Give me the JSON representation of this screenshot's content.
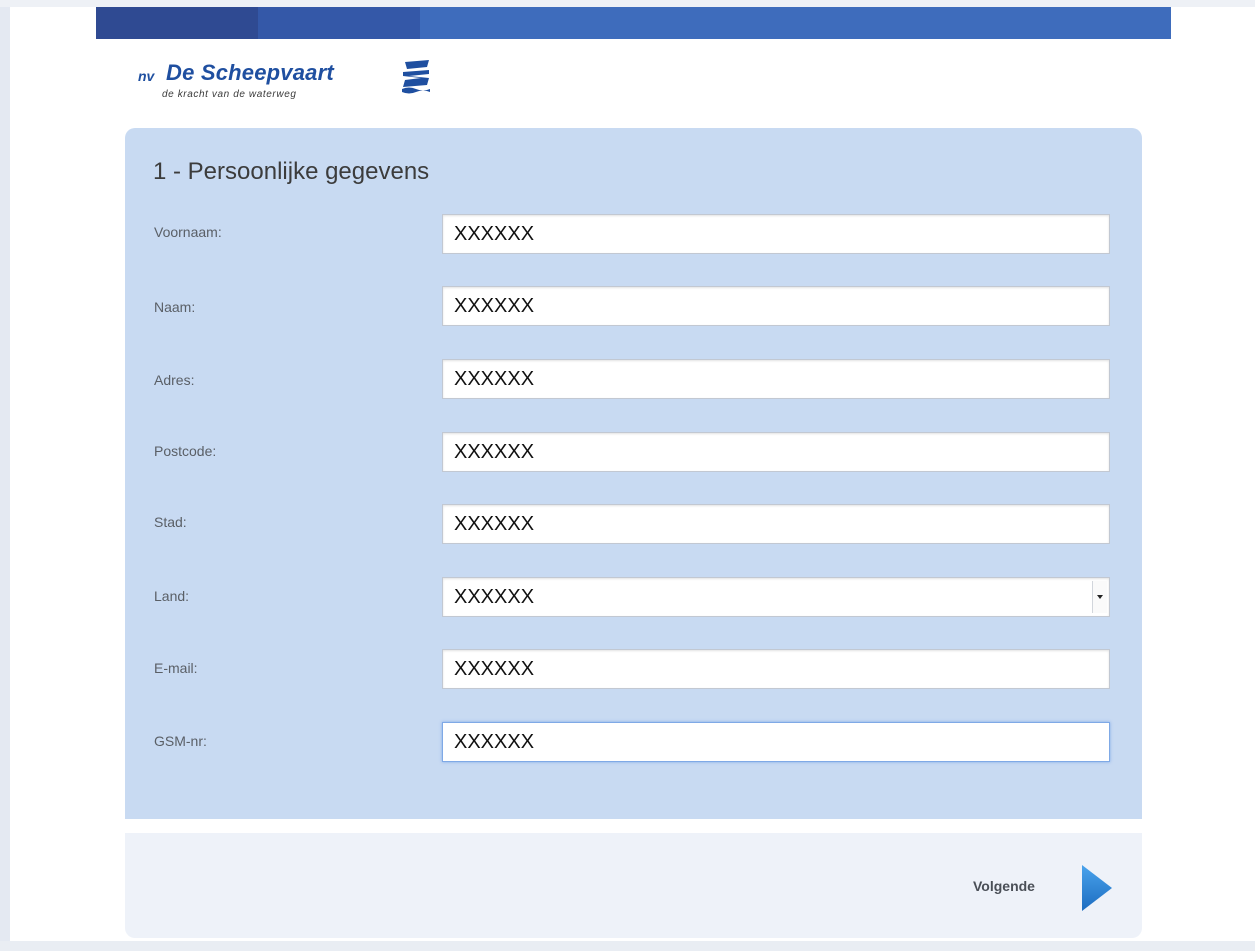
{
  "logo": {
    "prefix": "nv",
    "name": "De Scheepvaart",
    "tagline": "de kracht van de waterweg"
  },
  "form": {
    "title": "1 - Persoonlijke gegevens",
    "fields": [
      {
        "label": "Voornaam:",
        "value": "XXXXXX"
      },
      {
        "label": "Naam:",
        "value": "XXXXXX"
      },
      {
        "label": "Adres:",
        "value": "XXXXXX"
      },
      {
        "label": "Postcode:",
        "value": "XXXXXX"
      },
      {
        "label": "Stad:",
        "value": "XXXXXX"
      },
      {
        "label": "Land:",
        "value": "XXXXXX",
        "type": "select"
      },
      {
        "label": "E-mail:",
        "value": "XXXXXX"
      },
      {
        "label": "GSM-nr:",
        "value": "XXXXXX"
      }
    ]
  },
  "footer": {
    "next_label": "Volgende"
  },
  "colors": {
    "brand_blue": "#1f4fa0",
    "panel_bg": "#c8daf2",
    "footer_bg": "#eef2f9",
    "arrow_blue": "#2f7fd0"
  },
  "icons": {
    "logo_mark": "scheepvaart-logo-icon",
    "next": "arrow-right-icon",
    "select": "chevron-down-icon"
  }
}
